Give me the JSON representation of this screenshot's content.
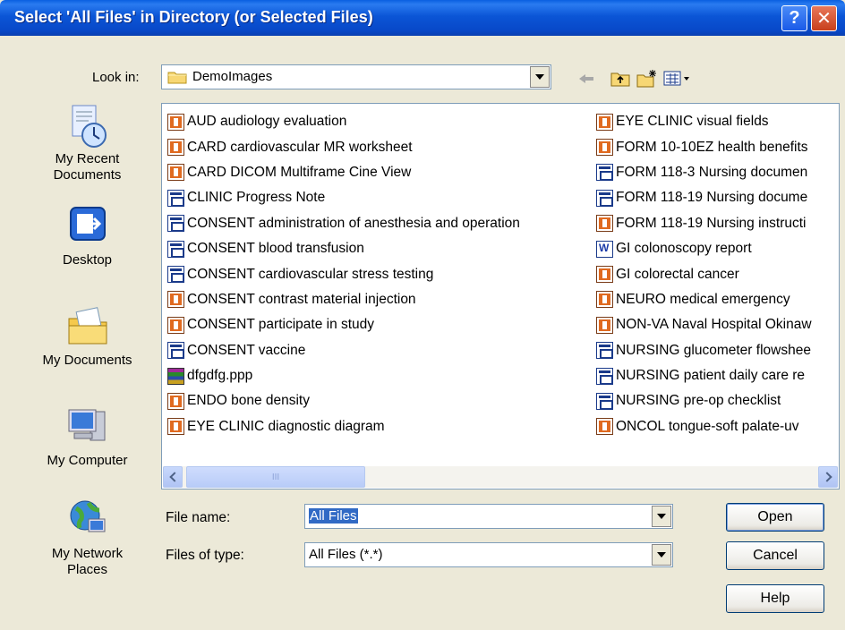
{
  "window": {
    "title": "Select 'All Files' in Directory (or Selected Files)",
    "help_glyph": "?",
    "close_glyph": "✕"
  },
  "look_in": {
    "label": "Look in:",
    "value": "DemoImages"
  },
  "places": [
    {
      "label": "My Recent Documents",
      "icon": "recent-documents-icon"
    },
    {
      "label": "Desktop",
      "icon": "desktop-icon"
    },
    {
      "label": "My Documents",
      "icon": "my-documents-icon"
    },
    {
      "label": "My Computer",
      "icon": "my-computer-icon"
    },
    {
      "label": "My Network Places",
      "icon": "network-places-icon"
    }
  ],
  "files_col1": [
    {
      "name": "AUD audiology evaluation",
      "icon": "pdf"
    },
    {
      "name": "CARD cardiovascular MR worksheet",
      "icon": "pdf"
    },
    {
      "name": "CARD DICOM Multiframe Cine View",
      "icon": "pdf"
    },
    {
      "name": "CLINIC Progress Note",
      "icon": "form"
    },
    {
      "name": "CONSENT administration of anesthesia and operation",
      "icon": "form"
    },
    {
      "name": "CONSENT blood transfusion",
      "icon": "form"
    },
    {
      "name": "CONSENT cardiovascular stress testing",
      "icon": "form"
    },
    {
      "name": "CONSENT contrast material injection",
      "icon": "pdf"
    },
    {
      "name": "CONSENT participate in study",
      "icon": "pdf"
    },
    {
      "name": "CONSENT vaccine",
      "icon": "form"
    },
    {
      "name": "dfgdfg.ppp",
      "icon": "rar"
    },
    {
      "name": "ENDO bone density",
      "icon": "pdf"
    },
    {
      "name": "EYE CLINIC diagnostic diagram",
      "icon": "pdf"
    }
  ],
  "files_col2": [
    {
      "name": "EYE CLINIC visual fields",
      "icon": "pdf"
    },
    {
      "name": "FORM 10-10EZ health benefits",
      "icon": "pdf"
    },
    {
      "name": "FORM 118-3 Nursing documen",
      "icon": "form"
    },
    {
      "name": "FORM 118-19 Nursing docume",
      "icon": "form"
    },
    {
      "name": "FORM 118-19 Nursing instructi",
      "icon": "pdf"
    },
    {
      "name": "GI colonoscopy report",
      "icon": "word"
    },
    {
      "name": "GI colorectal cancer",
      "icon": "pdf"
    },
    {
      "name": "NEURO medical emergency",
      "icon": "pdf"
    },
    {
      "name": "NON-VA Naval Hospital Okinaw",
      "icon": "pdf"
    },
    {
      "name": "NURSING glucometer flowshee",
      "icon": "form"
    },
    {
      "name": "NURSING patient daily care re",
      "icon": "form"
    },
    {
      "name": "NURSING pre-op checklist",
      "icon": "form"
    },
    {
      "name": "ONCOL tongue-soft palate-uv",
      "icon": "pdf"
    }
  ],
  "file_name": {
    "label": "File name:",
    "value": "All Files"
  },
  "file_type": {
    "label": "Files of type:",
    "value": "All Files (*.*)"
  },
  "buttons": {
    "open": "Open",
    "cancel": "Cancel",
    "help": "Help"
  },
  "scroll_grip": "III"
}
